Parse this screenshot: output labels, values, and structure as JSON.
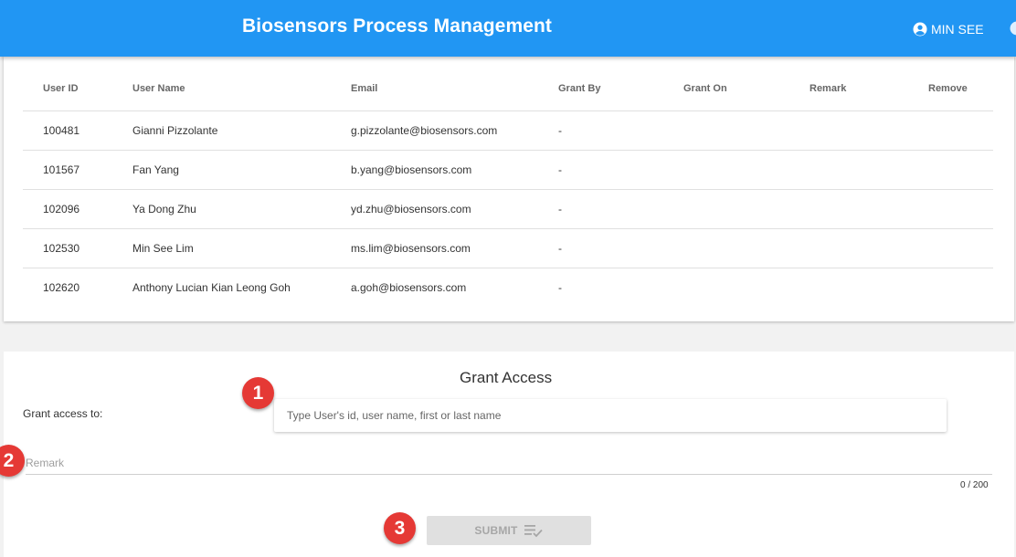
{
  "header": {
    "title": "Biosensors Process Management",
    "user_name": "MIN SEE"
  },
  "table": {
    "columns": [
      "User ID",
      "User Name",
      "Email",
      "Grant By",
      "Grant On",
      "Remark",
      "Remove"
    ],
    "rows": [
      [
        "100481",
        "Gianni Pizzolante",
        "g.pizzolante@biosensors.com",
        "-",
        "",
        "",
        ""
      ],
      [
        "101567",
        "Fan Yang",
        "b.yang@biosensors.com",
        "-",
        "",
        "",
        ""
      ],
      [
        "102096",
        "Ya Dong Zhu",
        "yd.zhu@biosensors.com",
        "-",
        "",
        "",
        ""
      ],
      [
        "102530",
        "Min See Lim",
        "ms.lim@biosensors.com",
        "-",
        "",
        "",
        ""
      ],
      [
        "102620",
        "Anthony Lucian Kian Leong Goh",
        "a.goh@biosensors.com",
        "-",
        "",
        "",
        ""
      ]
    ]
  },
  "grant": {
    "title": "Grant Access",
    "label": "Grant access to:",
    "input_placeholder": "Type User's id, user name, first or last name",
    "remark_placeholder": "Remark",
    "counter": "0 / 200",
    "submit_label": "SUBMIT"
  },
  "annotations": [
    "1",
    "2",
    "3"
  ],
  "colors": {
    "appbar": "#2196f3",
    "badge": "#e53935",
    "submit_disabled_bg": "#e0e0e0"
  },
  "icons": {
    "user": "account-circle-icon",
    "submit": "playlist-check-icon"
  }
}
